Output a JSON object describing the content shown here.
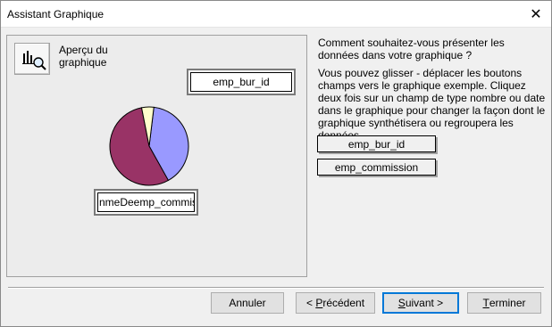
{
  "window": {
    "title": "Assistant Graphique",
    "close_glyph": "✕"
  },
  "preview": {
    "label": "Aperçu du graphique",
    "series_field": "emp_bur_id",
    "data_field": "nmeDeemp_commiss",
    "pie_colors": [
      "#9999ff",
      "#993366",
      "#ffffcc"
    ],
    "pie_slices": [
      0.4,
      0.55,
      0.05
    ]
  },
  "instructions": {
    "question": "Comment souhaitez-vous présenter les données dans votre graphique ?",
    "help": "Vous pouvez glisser - déplacer les boutons champs vers le graphique exemple. Cliquez deux fois sur un champ de type nombre ou date dans le graphique pour changer la façon dont le graphique synthétisera ou regroupera les données."
  },
  "fields": [
    {
      "label": "emp_bur_id"
    },
    {
      "label": "emp_commission"
    }
  ],
  "buttons": {
    "cancel": "Annuler",
    "previous_prefix": "< ",
    "previous_accel": "P",
    "previous_rest": "récédent",
    "next_accel": "S",
    "next_rest": "uivant >",
    "finish_accel": "T",
    "finish_rest": "erminer"
  },
  "icons": {
    "chart": "chart-zoom-icon",
    "close": "close-icon"
  }
}
